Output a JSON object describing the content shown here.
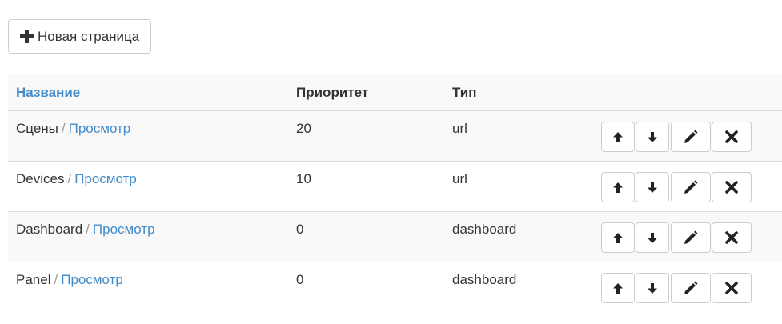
{
  "toolbar": {
    "new_page_label": "Новая страница",
    "new_page_icon": "plus-icon"
  },
  "table": {
    "columns": [
      "Название",
      "Приоритет",
      "Тип"
    ],
    "view_link_label": "Просмотр",
    "separator": "/",
    "row_actions": [
      "arrow-up-icon",
      "arrow-down-icon",
      "pencil-icon",
      "close-icon"
    ],
    "rows": [
      {
        "name": "Сцены",
        "priority": "20",
        "type": "url"
      },
      {
        "name": "Devices",
        "priority": "10",
        "type": "url"
      },
      {
        "name": "Dashboard",
        "priority": "0",
        "type": "dashboard"
      },
      {
        "name": "Panel",
        "priority": "0",
        "type": "dashboard"
      }
    ]
  },
  "colors": {
    "link": "#428bca",
    "text": "#333333",
    "separator": "#999999",
    "stripe": "#f9f9f9",
    "border": "#dddddd"
  }
}
